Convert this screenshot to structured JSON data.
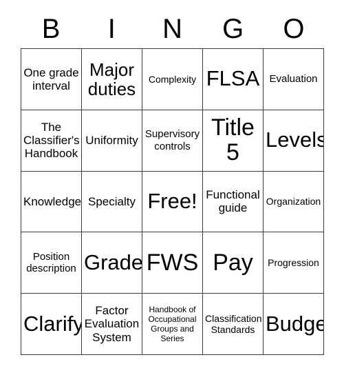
{
  "card": {
    "title": "BINGO card",
    "header_letters": [
      "B",
      "I",
      "N",
      "G",
      "O"
    ],
    "grid_size": "5x5",
    "free_space": "Free!",
    "colors": {
      "background": "#ffffff",
      "text": "#000000",
      "border": "#3a3a3a"
    },
    "rows": [
      [
        {
          "text": "One grade interval",
          "size": "sz-m"
        },
        {
          "text": "Major duties",
          "size": "sz-xl"
        },
        {
          "text": "Complexity",
          "size": "sz-s"
        },
        {
          "text": "FLSA",
          "size": "sz-xxl"
        },
        {
          "text": "Evaluation",
          "size": "sz-sm"
        }
      ],
      [
        {
          "text": "The Classifier's Handbook",
          "size": "sz-m"
        },
        {
          "text": "Uniformity",
          "size": "sz-m"
        },
        {
          "text": "Supervisory controls",
          "size": "sz-sm"
        },
        {
          "text": "Title 5",
          "size": "sz-3xl"
        },
        {
          "text": "Levels",
          "size": "sz-xxl"
        }
      ],
      [
        {
          "text": "Knowledge",
          "size": "sz-m"
        },
        {
          "text": "Specialty",
          "size": "sz-m"
        },
        {
          "text": "Free!",
          "size": "sz-xxl"
        },
        {
          "text": "Functional guide",
          "size": "sz-m"
        },
        {
          "text": "Organization",
          "size": "sz-s"
        }
      ],
      [
        {
          "text": "Position description",
          "size": "sz-sm"
        },
        {
          "text": "Grade",
          "size": "sz-xxl"
        },
        {
          "text": "FWS",
          "size": "sz-3xl"
        },
        {
          "text": "Pay",
          "size": "sz-3xl"
        },
        {
          "text": "Progression",
          "size": "sz-s"
        }
      ],
      [
        {
          "text": "Clarify",
          "size": "sz-xxl"
        },
        {
          "text": "Factor Evaluation System",
          "size": "sz-m"
        },
        {
          "text": "Handbook of Occupational Groups and Series",
          "size": "sz-xs"
        },
        {
          "text": "Classification Standards",
          "size": "sz-s"
        },
        {
          "text": "Budget",
          "size": "sz-xxl"
        }
      ]
    ]
  }
}
